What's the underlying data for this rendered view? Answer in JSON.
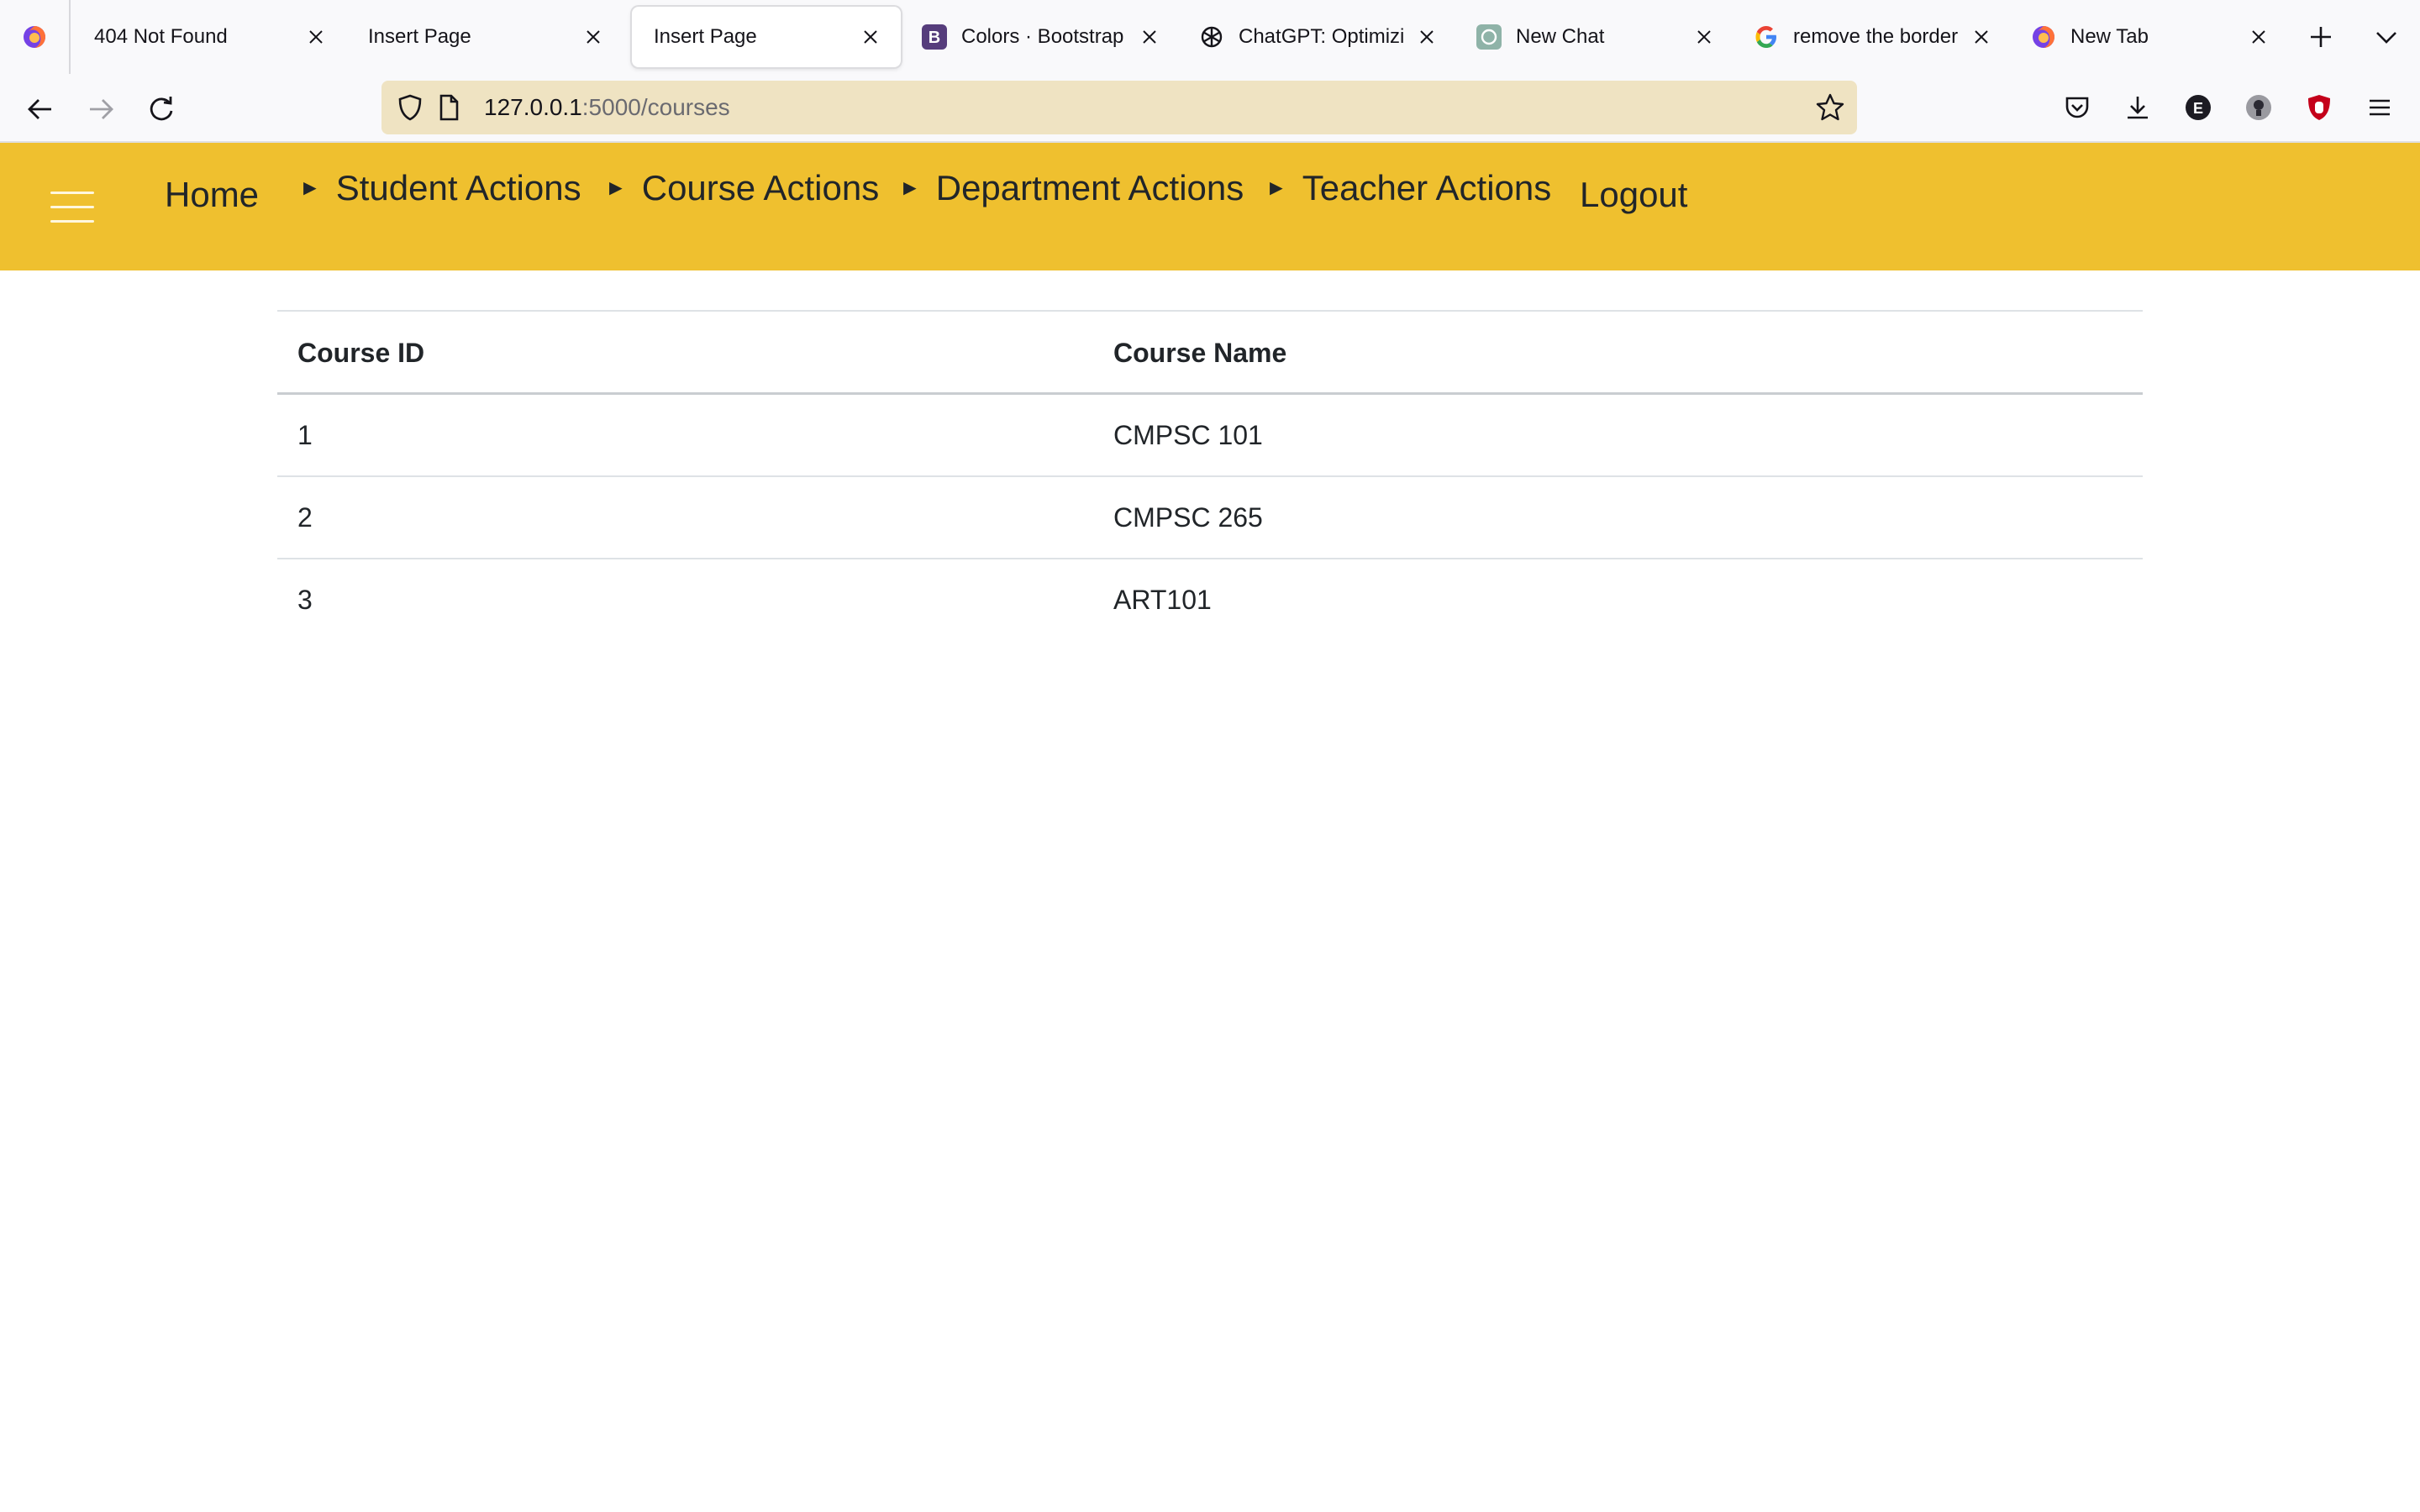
{
  "browser": {
    "tabs": [
      {
        "title": "404 Not Found",
        "favicon": "none",
        "active": false
      },
      {
        "title": "Insert Page",
        "favicon": "none",
        "active": false
      },
      {
        "title": "Insert Page",
        "favicon": "none",
        "active": true
      },
      {
        "title": "Colors · Bootstrap",
        "favicon": "bootstrap-icon",
        "active": false
      },
      {
        "title": "ChatGPT: Optimizing",
        "favicon": "openai-icon",
        "active": false
      },
      {
        "title": "New Chat",
        "favicon": "chat-icon",
        "active": false
      },
      {
        "title": "remove the border fr",
        "favicon": "google-icon",
        "active": false
      },
      {
        "title": "New Tab",
        "favicon": "firefox-icon",
        "active": false
      }
    ],
    "url": {
      "host": "127.0.0.1",
      "path": ":5000/courses"
    },
    "extensions": [
      {
        "name": "pocket-icon"
      },
      {
        "name": "download-icon"
      },
      {
        "name": "extension-e-icon",
        "label": "E"
      },
      {
        "name": "extension-bulb-icon"
      },
      {
        "name": "ublock-icon"
      },
      {
        "name": "menu-icon"
      }
    ],
    "colors": {
      "tabstrip": "#f9f9fb",
      "urlbar": "#efe3c2",
      "accent": "#efc02f"
    }
  },
  "site": {
    "nav": {
      "home": "Home",
      "student_actions": "Student Actions",
      "course_actions": "Course Actions",
      "department_actions": "Department Actions",
      "teacher_actions": "Teacher Actions",
      "logout": "Logout",
      "disclosure": "►"
    },
    "table": {
      "headers": [
        "Course ID",
        "Course Name"
      ],
      "rows": [
        [
          "1",
          "CMPSC 101"
        ],
        [
          "2",
          "CMPSC 265"
        ],
        [
          "3",
          "ART101"
        ]
      ]
    },
    "colors": {
      "navbar": "#efc02f",
      "text": "#212529",
      "divider": "#dee2e6"
    }
  }
}
